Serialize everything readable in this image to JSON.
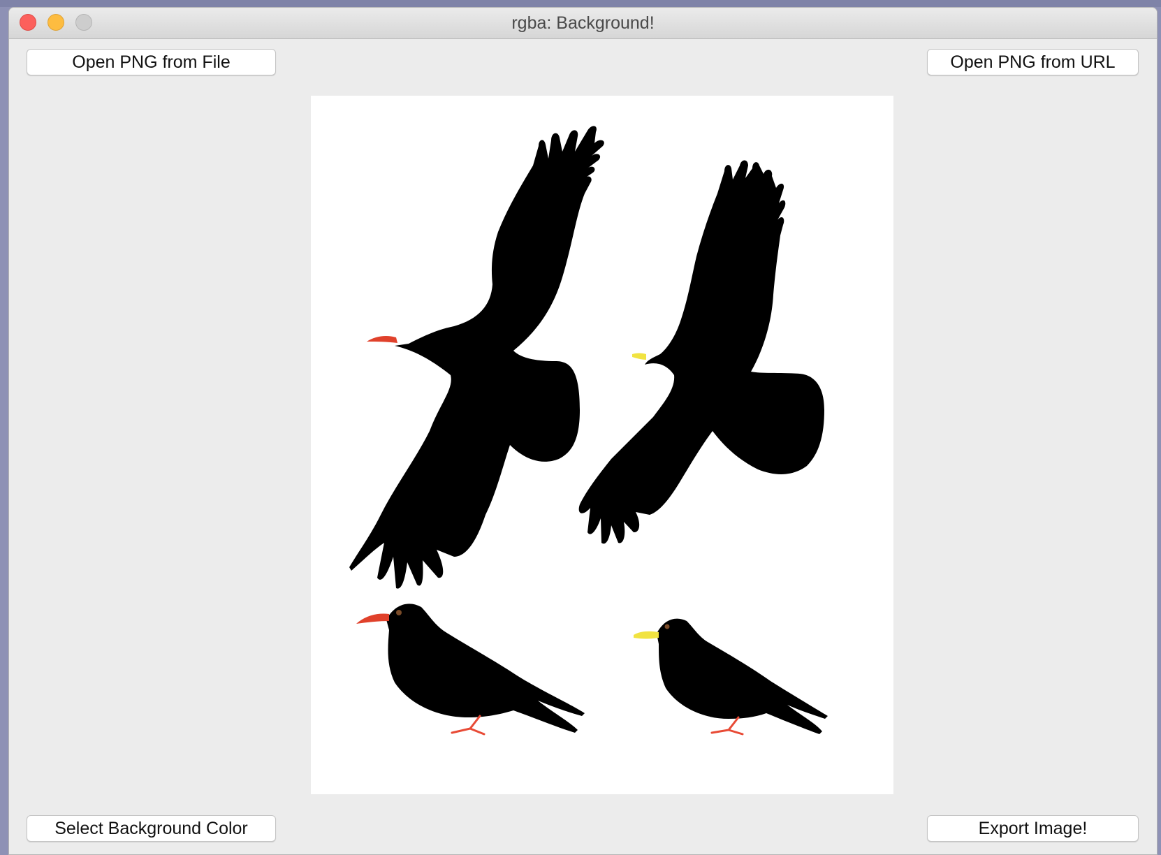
{
  "window": {
    "title": "rgba: Background!"
  },
  "buttons": {
    "open_file": "Open PNG from File",
    "open_url": "Open PNG from URL",
    "select_bg": "Select Background Color",
    "export": "Export Image!"
  },
  "image": {
    "background_color": "#ffffff",
    "bird_color": "#000000",
    "red_beak_color": "#e0412b",
    "yellow_beak_color": "#f1e341",
    "leg_color": "#e84a35",
    "content": [
      "chough-red-billed-flying-icon",
      "chough-yellow-billed-flying-icon",
      "chough-red-billed-perched-icon",
      "chough-yellow-billed-perched-icon"
    ]
  }
}
